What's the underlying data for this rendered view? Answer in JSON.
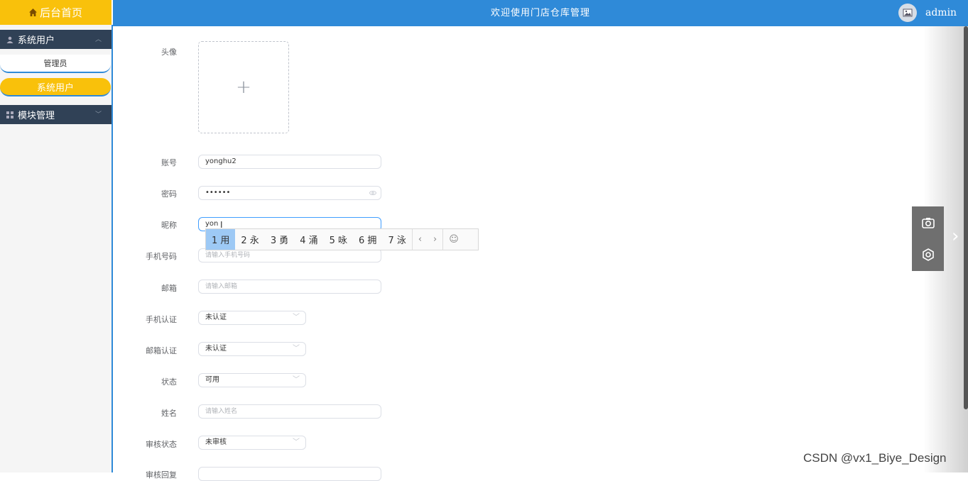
{
  "header": {
    "home_label": "后台首页",
    "title": "欢迎使用门店仓库管理",
    "username": "admin"
  },
  "sidebar": {
    "group1": {
      "label": "系统用户",
      "items": [
        {
          "label": "管理员"
        },
        {
          "label": "系统用户"
        }
      ]
    },
    "group2": {
      "label": "模块管理"
    }
  },
  "form": {
    "avatar_label": "头像",
    "account_label": "账号",
    "account_value": "yonghu2",
    "password_label": "密码",
    "password_value": "••••••",
    "nickname_label": "昵称",
    "nickname_value": "yon",
    "phone_label": "手机号码",
    "phone_placeholder": "请输入手机号码",
    "email_label": "邮箱",
    "email_placeholder": "请输入邮箱",
    "phone_verify_label": "手机认证",
    "phone_verify_value": "未认证",
    "email_verify_label": "邮箱认证",
    "email_verify_value": "未认证",
    "status_label": "状态",
    "status_value": "可用",
    "name_label": "姓名",
    "name_placeholder": "请输入姓名",
    "review_label": "审核状态",
    "review_value": "未审核",
    "next_label": "审核回复"
  },
  "ime": {
    "candidates": [
      "1 用",
      "2 永",
      "3 勇",
      "4 涌",
      "5 咏",
      "6 拥",
      "7 泳"
    ],
    "prev": "‹",
    "next": "›",
    "emoji": "☺"
  },
  "watermark": "CSDN @vx1_Biye_Design"
}
